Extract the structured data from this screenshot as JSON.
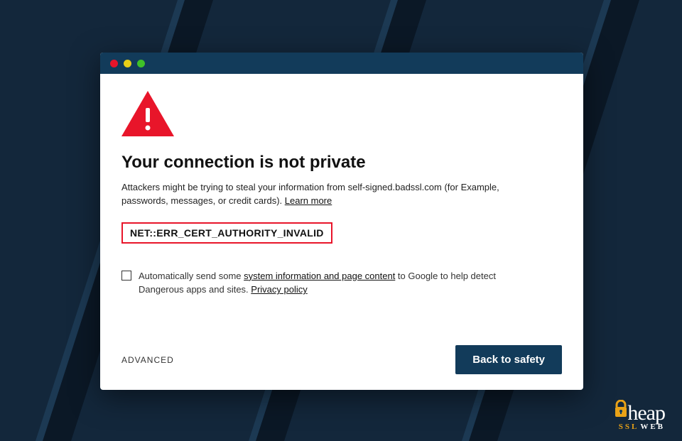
{
  "window": {
    "traffic_lights": [
      "red",
      "yellow",
      "green"
    ]
  },
  "page": {
    "heading": "Your connection is not private",
    "warning_text_pre": "Attackers might be trying to steal your information from self-signed.badssl.com (for Example, passwords, messages, or credit cards). ",
    "learn_more": "Learn more",
    "error_code": "NET::ERR_CERT_AUTHORITY_INVALID",
    "optin_pre": "Automatically send some ",
    "optin_link1": "system information and page content",
    "optin_mid": " to Google to help detect Dangerous apps and sites. ",
    "optin_link2": "Privacy policy",
    "advanced_label": "ADVANCED",
    "back_button": "Back to safety"
  },
  "branding": {
    "name_rest": "heap",
    "ssl": "SSL",
    "web": "WEB"
  }
}
